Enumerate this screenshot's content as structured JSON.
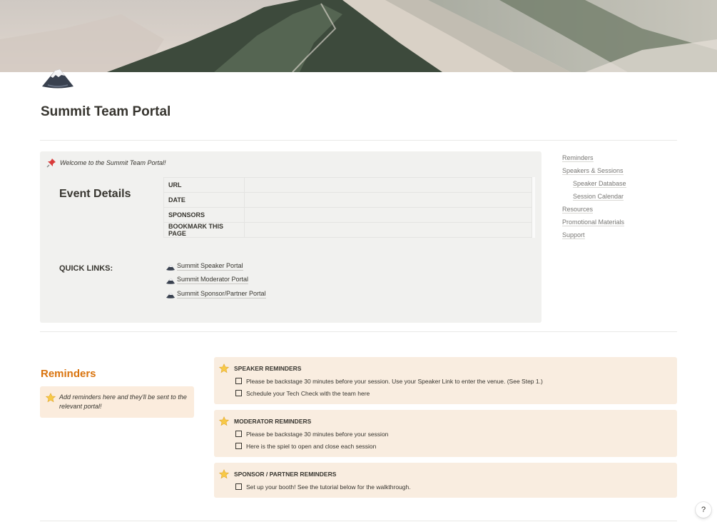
{
  "page": {
    "title": "Summit Team Portal"
  },
  "callout": {
    "welcome_text": "Welcome to the Summit Team Portal!",
    "event_details_heading": "Event Details",
    "details_rows": [
      {
        "key": "URL",
        "value": ""
      },
      {
        "key": "DATE",
        "value": ""
      },
      {
        "key": "SPONSORS",
        "value": ""
      },
      {
        "key": "BOOKMARK THIS PAGE",
        "value": ""
      }
    ],
    "quick_links_heading": "QUICK LINKS:",
    "quick_links": [
      "Summit Speaker Portal",
      "Summit Moderator Portal",
      "Summit Sponsor/Partner Portal"
    ]
  },
  "toc": {
    "items": [
      {
        "label": "Reminders",
        "indent": 0
      },
      {
        "label": "Speakers & Sessions",
        "indent": 0
      },
      {
        "label": "Speaker Database",
        "indent": 1
      },
      {
        "label": "Session Calendar",
        "indent": 1
      },
      {
        "label": "Resources",
        "indent": 0
      },
      {
        "label": "Promotional Materials",
        "indent": 0
      },
      {
        "label": "Support",
        "indent": 0
      }
    ]
  },
  "reminders": {
    "heading": "Reminders",
    "callout_text": "Add reminders here and they'll be sent to the relevant portal!",
    "groups": [
      {
        "title": "SPEAKER REMINDERS",
        "items": [
          "Please be backstage 30 minutes before your session. Use your Speaker Link to enter the venue. (See Step 1.)",
          "Schedule your Tech Check with the team here"
        ]
      },
      {
        "title": "MODERATOR REMINDERS",
        "items": [
          "Please be backstage 30 minutes before your session",
          "Here is the spiel to open and close each session"
        ]
      },
      {
        "title": "SPONSOR / PARTNER REMINDERS",
        "items": [
          "Set up your booth! See the tutorial below for the walkthrough."
        ]
      }
    ]
  },
  "help": {
    "label": "?"
  },
  "colors": {
    "heading_orange": "#d9730d",
    "callout_gray": "#f1f1ef",
    "reminder_bg": "#f9ede0",
    "text": "#37352f"
  }
}
